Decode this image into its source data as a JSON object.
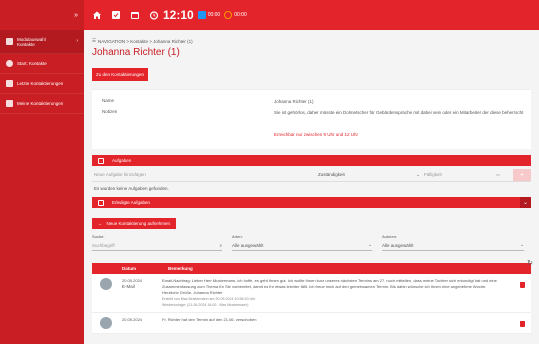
{
  "topbar": {
    "clock": "12:10",
    "stat1": "00:00",
    "stat2": "00:00",
    "icons": [
      "home-icon",
      "checklist-icon",
      "calendar-icon",
      "timer-icon"
    ],
    "accent": "#e3242b"
  },
  "sidebar": {
    "items": [
      {
        "label": "Modulauswahl\nKontakte",
        "icon": "grid-icon"
      },
      {
        "label": "Start: Kontakte",
        "icon": "start-icon"
      },
      {
        "label": "Letzte Kontaktierungen",
        "icon": "list-icon"
      },
      {
        "label": "Meine Kontaktierungen",
        "icon": "list-icon"
      }
    ]
  },
  "main": {
    "breadcrumb": "NAVIGATION > Kontakte > Johanna Richter (1)",
    "title": "Johanna Richter (1)",
    "to_contact_button": "Zu den Kontaktierungen",
    "info": {
      "name_label": "Name",
      "name_value": "Johanna Richter (1)",
      "notes_label": "Notizen",
      "notes_value": "Sie ist gehörlos, daher müsste ein Dolmetscher für Gebärdensprache mit dabei sein oder ein Mitarbeiter der diese beherrscht",
      "hint": "Erreichbar nur zwischen 9 Uhr und 12 Uhr"
    },
    "tasks": {
      "section_title": "Aufgaben",
      "input_placeholder": "Neue Aufgabe hinzufügen",
      "responsible_label": "Zuständigkeit",
      "due_placeholder": "Fälligkeit",
      "add_label": "+",
      "empty_text": "Es wurden keine Aufgaben gefunden."
    },
    "done_tasks": {
      "section_title": "Erledigte Aufgaben"
    },
    "new_contact_button": "Neue Kontaktierung aufnehmen",
    "filters": {
      "search_label": "Suche:",
      "search_placeholder": "Suchbegriff",
      "type_label": "Arten:",
      "type_value": "Alle ausgewählt",
      "author_label": "Autoren:",
      "author_value": "Alle ausgewählt"
    },
    "table": {
      "col_date": "Datum",
      "col_note": "Bemerkung",
      "rows": [
        {
          "date": "20.05.2024",
          "type": "E-Mail",
          "note": "Email-Nachtrag: Lieber Herr Mustermann, ich hoffe, es geht Ihnen gut. Ich wollte Ihnen kurz unseres nächsten Termins am 27. noch mitteilen, dass meine Tochter sich erkundigt hat und eine Zusammenfassung zum Thema für Sie vorbereitet, damit es Ihr etwas leichter fällt. Ich freue mich auf den gemeinsamen Termin. Bis dahin wünsche ich Ihnen eine angenehme Woche. Herzliche Grüße, Johanna Richter",
          "meta1": "Erstellt von Max Mustermann am 20.05.2024 10:58:20 Uhr",
          "meta2": "Wiedervorlage: (21.06.2024 16:00 - Max Mustermann)"
        },
        {
          "date": "20.05.2024",
          "type": "",
          "note": "Fr. Richter hat den Termin auf den 21.06. verschoben",
          "meta1": "",
          "meta2": ""
        }
      ]
    }
  }
}
